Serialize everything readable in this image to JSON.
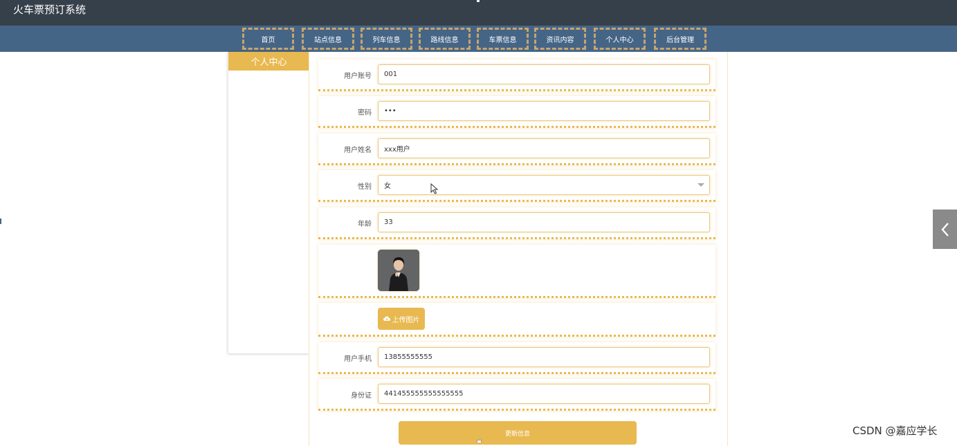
{
  "app": {
    "title": "火车票预订系统"
  },
  "nav": {
    "items": [
      {
        "label": "首页"
      },
      {
        "label": "站点信息"
      },
      {
        "label": "列车信息"
      },
      {
        "label": "路线信息"
      },
      {
        "label": "车票信息"
      },
      {
        "label": "资讯内容"
      },
      {
        "label": "个人中心"
      },
      {
        "label": "后台管理"
      }
    ]
  },
  "sidebar": {
    "title": "个人中心"
  },
  "form": {
    "account": {
      "label": "用户账号",
      "value": "001"
    },
    "password": {
      "label": "密码",
      "value": "•••"
    },
    "name": {
      "label": "用户姓名",
      "value": "xxx用户"
    },
    "gender": {
      "label": "性别",
      "value": "女"
    },
    "age": {
      "label": "年龄",
      "value": "33"
    },
    "upload_label": "上传图片",
    "phone": {
      "label": "用户手机",
      "value": "13855555555"
    },
    "idcard": {
      "label": "身份证",
      "value": "441455555555555555"
    },
    "submit_label": "更新信息"
  },
  "watermark": {
    "text": "CSDN @嘉应学长"
  },
  "colors": {
    "accent": "#e8b950",
    "topbar": "#36404a",
    "navbar": "#456587"
  },
  "icons": {
    "upload": "cloud-upload-icon",
    "collapse": "chevron-left-icon"
  }
}
